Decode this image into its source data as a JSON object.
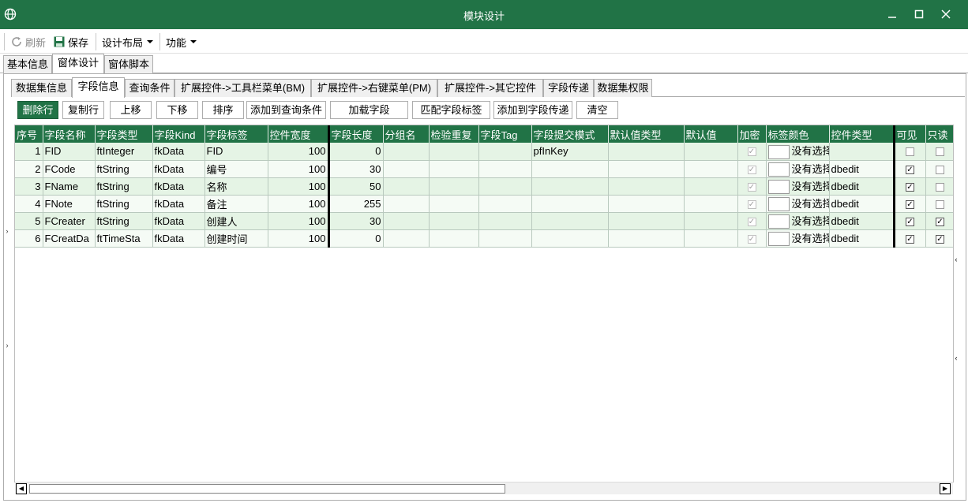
{
  "window": {
    "title": "模块设计",
    "app_icon": "globe-icon"
  },
  "toolbar": {
    "refresh_label": "刷新",
    "save_label": "保存",
    "layout_label": "设计布局",
    "function_label": "功能"
  },
  "main_tabs": [
    {
      "label": "基本信息"
    },
    {
      "label": "窗体设计"
    },
    {
      "label": "窗体脚本"
    }
  ],
  "sub_tabs": [
    {
      "label": "数据集信息"
    },
    {
      "label": "字段信息"
    },
    {
      "label": "查询条件"
    },
    {
      "label": "扩展控件->工具栏菜单(BM)"
    },
    {
      "label": "扩展控件->右键菜单(PM)"
    },
    {
      "label": "扩展控件->其它控件"
    },
    {
      "label": "字段传递"
    },
    {
      "label": "数据集权限"
    }
  ],
  "actions": {
    "delete_row": "删除行",
    "copy_row": "复制行",
    "move_up": "上移",
    "move_down": "下移",
    "sort": "排序",
    "add_to_query": "添加到查询条件",
    "load_fields": "加载字段",
    "match_labels": "匹配字段标签",
    "add_to_transfer": "添加到字段传递",
    "clear": "清空"
  },
  "grid": {
    "columns": [
      "序号",
      "字段名称",
      "字段类型",
      "字段Kind",
      "字段标签",
      "控件宽度",
      "字段长度",
      "分组名",
      "检验重复",
      "字段Tag",
      "字段提交模式",
      "默认值类型",
      "默认值",
      "加密",
      "标签颜色",
      "控件类型",
      "可见",
      "只读"
    ],
    "rows": [
      {
        "no": "1",
        "name": "FID",
        "type": "ftInteger",
        "kind": "fkData",
        "label": "FID",
        "width": "100",
        "length": "0",
        "submit_mode": "pfInKey",
        "color_text": "没有选择",
        "control_type": "",
        "visible": false,
        "readonly": false
      },
      {
        "no": "2",
        "name": "FCode",
        "type": "ftString",
        "kind": "fkData",
        "label": "编号",
        "width": "100",
        "length": "30",
        "submit_mode": "",
        "color_text": "没有选择",
        "control_type": "dbedit",
        "visible": true,
        "readonly": false
      },
      {
        "no": "3",
        "name": "FName",
        "type": "ftString",
        "kind": "fkData",
        "label": "名称",
        "width": "100",
        "length": "50",
        "submit_mode": "",
        "color_text": "没有选择",
        "control_type": "dbedit",
        "visible": true,
        "readonly": false
      },
      {
        "no": "4",
        "name": "FNote",
        "type": "ftString",
        "kind": "fkData",
        "label": "备注",
        "width": "100",
        "length": "255",
        "submit_mode": "",
        "color_text": "没有选择",
        "control_type": "dbedit",
        "visible": true,
        "readonly": false
      },
      {
        "no": "5",
        "name": "FCreater",
        "type": "ftString",
        "kind": "fkData",
        "label": "创建人",
        "width": "100",
        "length": "30",
        "submit_mode": "",
        "color_text": "没有选择",
        "control_type": "dbedit",
        "visible": true,
        "readonly": true
      },
      {
        "no": "6",
        "name": "FCreatDa",
        "type": "ftTimeSta",
        "kind": "fkData",
        "label": "创建时间",
        "width": "100",
        "length": "0",
        "submit_mode": "",
        "color_text": "没有选择",
        "control_type": "dbedit",
        "visible": true,
        "readonly": true
      }
    ]
  },
  "colors": {
    "accent": "#217346",
    "row_odd": "#e5f4e5",
    "row_even": "#f5fbf5"
  }
}
